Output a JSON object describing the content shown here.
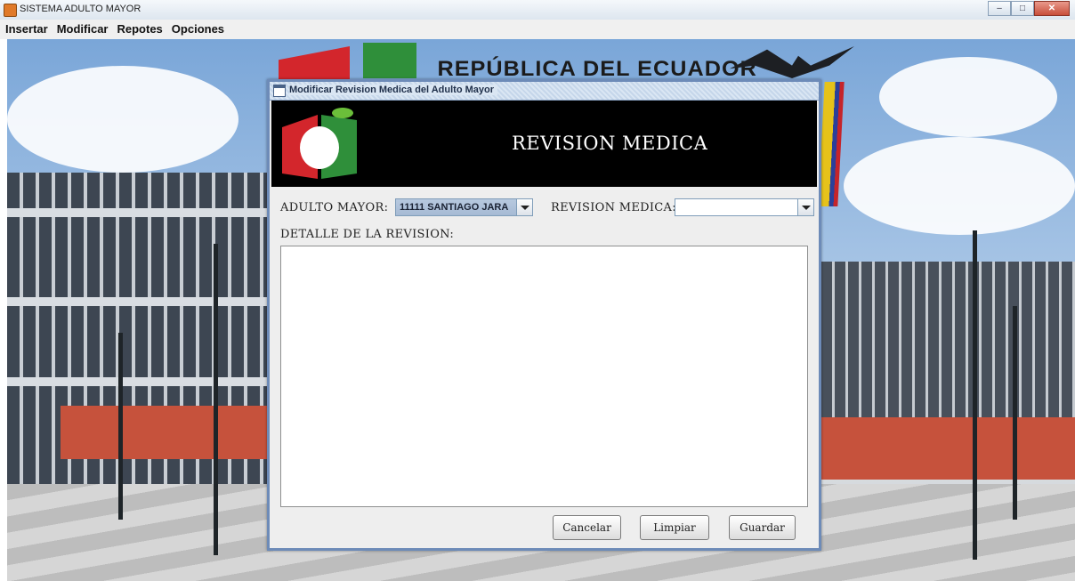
{
  "window": {
    "title": "SISTEMA ADULTO MAYOR",
    "controls": [
      "minimize-icon",
      "maximize-icon",
      "close-icon"
    ]
  },
  "menu": {
    "items": [
      "Insertar",
      "Modificar",
      "Repotes",
      "Opciones"
    ]
  },
  "background": {
    "banner_text": "REPÚBLICA DEL ECUADOR"
  },
  "dialog": {
    "title": "Modificar Revision Medica del Adulto Mayor",
    "header_title": "REVISION MEDICA",
    "adulto_label": "ADULTO MAYOR:",
    "adulto_value": "11111 SANTIAGO JARA",
    "revision_label": "REVISION MEDICA:",
    "revision_value": "",
    "detalle_label": "DETALLE DE LA REVISION:",
    "detalle_value": "",
    "buttons": {
      "cancel": "Cancelar",
      "clear": "Limpiar",
      "save": "Guardar"
    }
  },
  "colors": {
    "dialog_border": "#6d8bb8",
    "banner_bg": "#000000",
    "logo_red": "#d3262c",
    "logo_green": "#2f8f3a"
  }
}
